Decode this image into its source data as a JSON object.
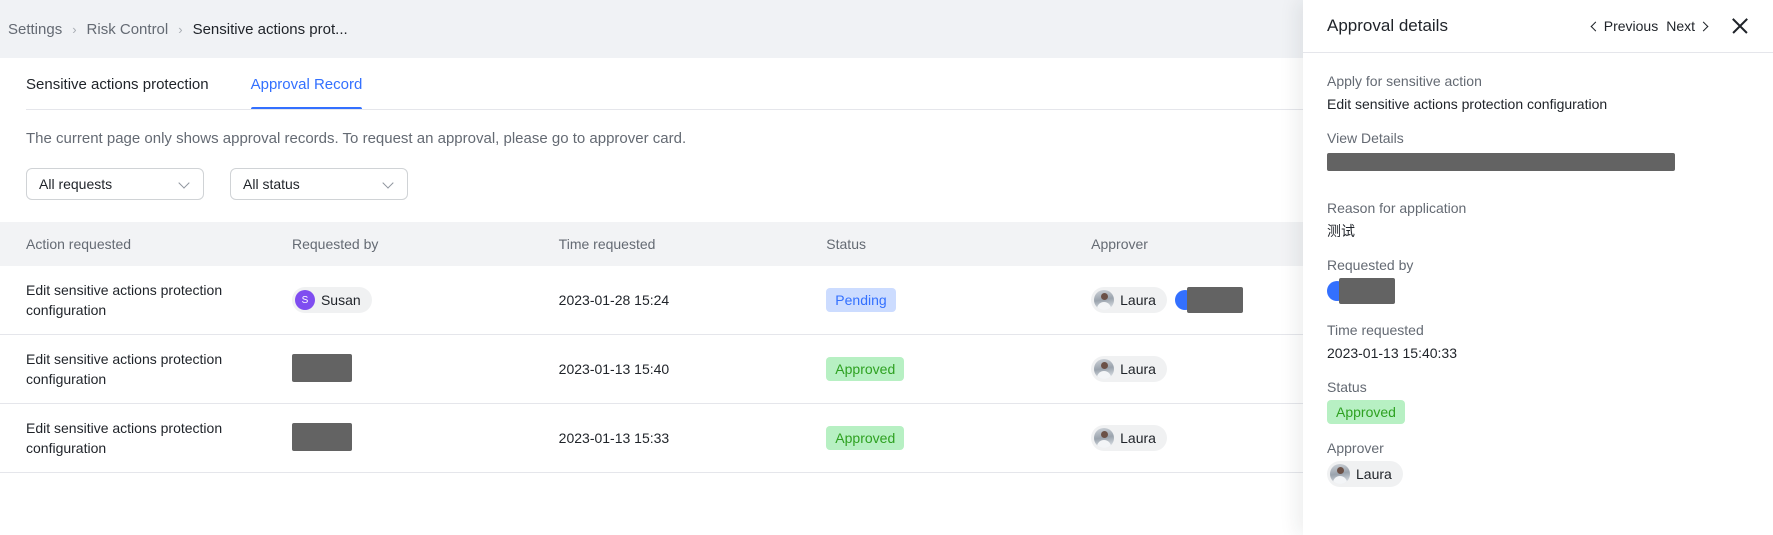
{
  "breadcrumb": {
    "items": [
      {
        "label": "Settings",
        "current": false
      },
      {
        "label": "Risk Control",
        "current": false
      },
      {
        "label": "Sensitive actions prot...",
        "current": true
      }
    ],
    "separator": "›"
  },
  "tabs": [
    {
      "label": "Sensitive actions protection",
      "active": false
    },
    {
      "label": "Approval Record",
      "active": true
    }
  ],
  "notice": "The current page only shows approval records. To request an approval, please go to approver card.",
  "filters": [
    {
      "name": "request-type-filter",
      "value": "All requests"
    },
    {
      "name": "status-filter",
      "value": "All status"
    }
  ],
  "table": {
    "columns": [
      "Action requested",
      "Requested by",
      "Time requested",
      "Status",
      "Approver"
    ],
    "rows": [
      {
        "action": "Edit sensitive actions protection configuration",
        "requested_by": {
          "name": "Susan",
          "redacted": false,
          "avatar_initial": "S",
          "avatar_color": "#7f4df0"
        },
        "time": "2023-01-28 15:24",
        "status": {
          "label": "Pending",
          "kind": "pending"
        },
        "approvers": [
          {
            "name": "Laura",
            "redacted": false
          },
          {
            "name": "",
            "redacted": true
          }
        ]
      },
      {
        "action": "Edit sensitive actions protection configuration",
        "requested_by": {
          "name": "",
          "redacted": true
        },
        "time": "2023-01-13 15:40",
        "status": {
          "label": "Approved",
          "kind": "approved"
        },
        "approvers": [
          {
            "name": "Laura",
            "redacted": false
          }
        ]
      },
      {
        "action": "Edit sensitive actions protection configuration",
        "requested_by": {
          "name": "",
          "redacted": true
        },
        "time": "2023-01-13 15:33",
        "status": {
          "label": "Approved",
          "kind": "approved"
        },
        "approvers": [
          {
            "name": "Laura",
            "redacted": false
          }
        ]
      }
    ]
  },
  "drawer": {
    "title": "Approval details",
    "previous_label": "Previous",
    "next_label": "Next",
    "fields": [
      {
        "label": "Apply for sensitive action",
        "value": "Edit sensitive actions protection configuration",
        "type": "text"
      },
      {
        "label": "View Details",
        "value": "",
        "type": "redacted-bar"
      },
      {
        "label": "Reason for application",
        "value": "测试",
        "type": "text"
      },
      {
        "label": "Requested by",
        "value": "",
        "type": "redacted-chip"
      },
      {
        "label": "Time requested",
        "value": "2023-01-13 15:40:33",
        "type": "text"
      },
      {
        "label": "Status",
        "value": "Approved",
        "type": "badge-approved"
      },
      {
        "label": "Approver",
        "value": "Laura",
        "type": "chip"
      }
    ]
  },
  "colors": {
    "accent": "#3370ff",
    "pending_bg": "#ccdcff",
    "pending_fg": "#3370ff",
    "approved_bg": "#b7f0c3",
    "approved_fg": "#2ea121",
    "page_bg": "#f0f2f5",
    "header_bg": "#f2f3f5"
  }
}
